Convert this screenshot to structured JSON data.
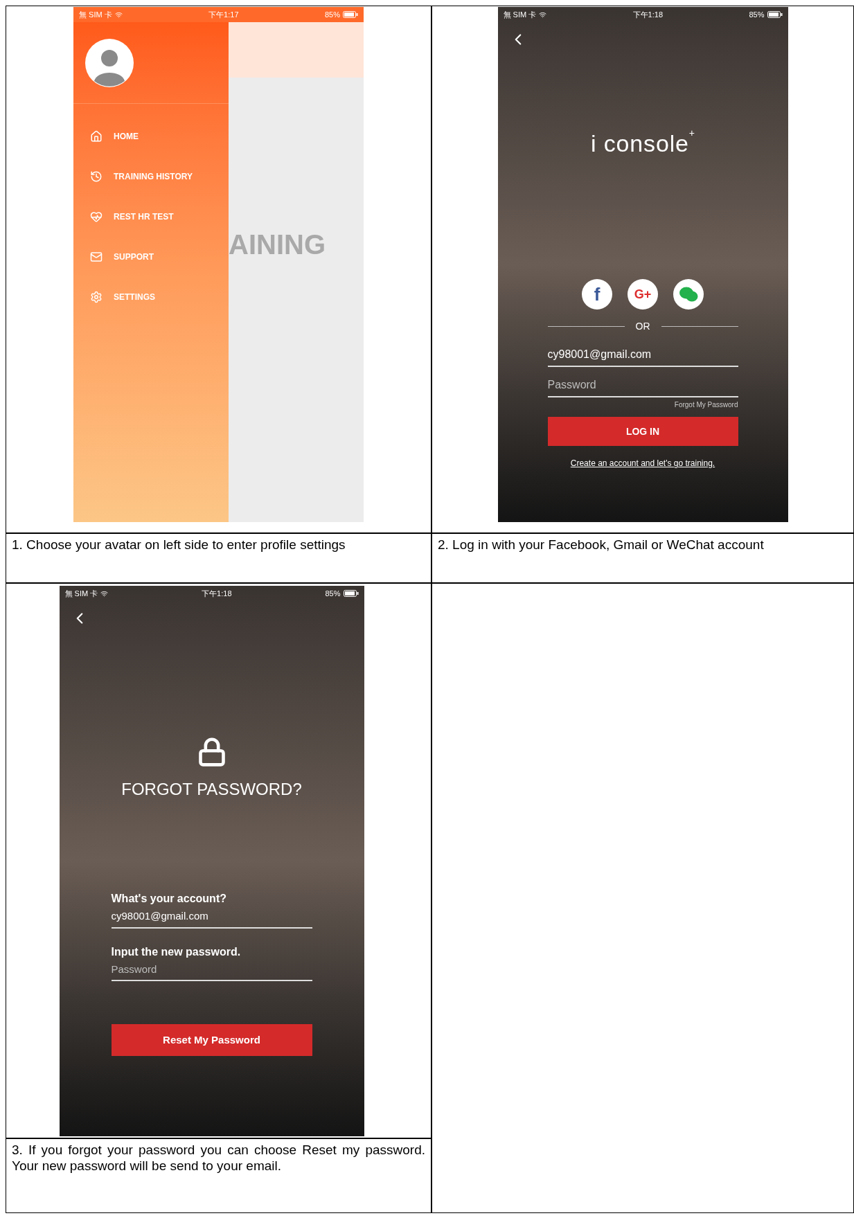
{
  "steps": [
    {
      "kind": "menu",
      "status_bar": {
        "carrier": "無 SIM 卡",
        "time": "下午1:17",
        "battery": "85%"
      },
      "menu_items": [
        {
          "label": "HOME"
        },
        {
          "label": "TRAINING HISTORY"
        },
        {
          "label": "REST HR TEST"
        },
        {
          "label": "SUPPORT"
        },
        {
          "label": "SETTINGS"
        }
      ],
      "background_text": "AINING",
      "caption": "1. Choose your avatar on left side to enter profile settings"
    },
    {
      "kind": "login",
      "status_bar": {
        "carrier": "無 SIM 卡",
        "time": "下午1:18",
        "battery": "85%"
      },
      "logo": "i console",
      "logo_mark": "+",
      "social": [
        {
          "kind": "facebook",
          "label": "f"
        },
        {
          "kind": "google",
          "label": "G+"
        },
        {
          "kind": "wechat"
        }
      ],
      "divider": "OR",
      "email": {
        "value": "cy98001@gmail.com"
      },
      "password": {
        "placeholder": "Password"
      },
      "forgot": "Forgot My Password",
      "button": "LOG IN",
      "link": "Create an account and let's go training.",
      "caption": "2. Log in with your Facebook, Gmail or WeChat account"
    },
    {
      "kind": "reset",
      "status_bar": {
        "carrier": "無 SIM 卡",
        "time": "下午1:18",
        "battery": "85%"
      },
      "title": "FORGOT PASSWORD?",
      "account_label": "What's your account?",
      "email": {
        "value": "cy98001@gmail.com"
      },
      "password_label": "Input the new password.",
      "password": {
        "placeholder": "Password"
      },
      "button": "Reset My Password",
      "caption": "3. If you forgot your password you can choose Reset my password. Your new password will be send to your email."
    }
  ]
}
